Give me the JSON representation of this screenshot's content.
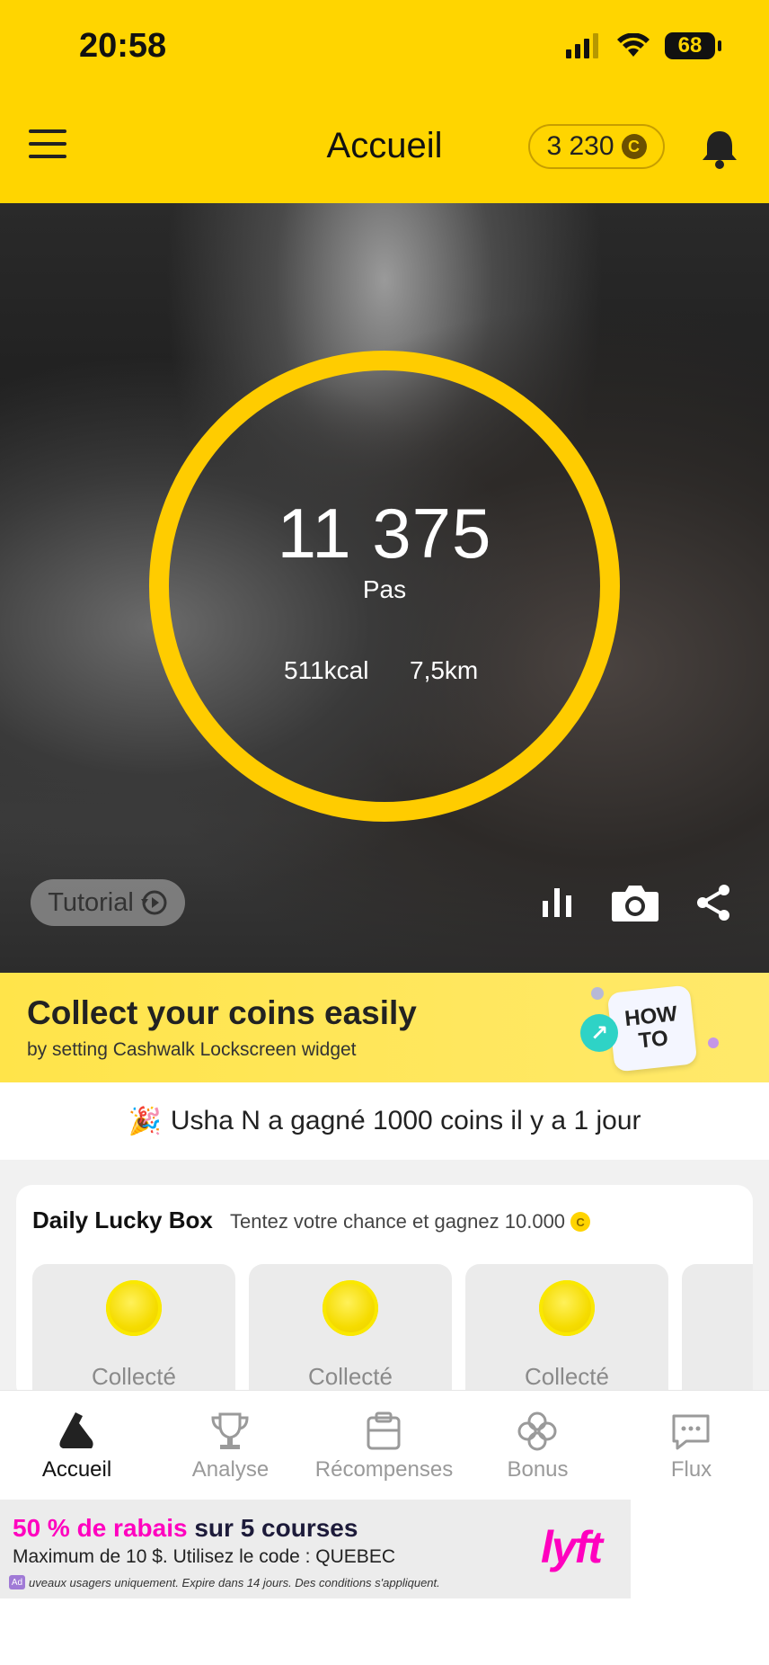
{
  "status_bar": {
    "time": "20:58",
    "battery": "68"
  },
  "header": {
    "title": "Accueil",
    "coins": "3 230",
    "coin_symbol": "C"
  },
  "activity": {
    "steps": "11 375",
    "steps_label": "Pas",
    "calories": "511kcal",
    "distance": "7,5km",
    "ring_color": "#FFCC00"
  },
  "hero_controls": {
    "tutorial_label": "Tutorial",
    "icons": [
      "stats-icon",
      "camera-icon",
      "share-icon"
    ]
  },
  "promo": {
    "title": "Collect your coins easily",
    "subtitle": "by setting Cashwalk Lockscreen widget",
    "howto": "HOW TO"
  },
  "winner": {
    "emoji": "🎉",
    "text": "Usha N a gagné 1000 coins il y a 1 jour"
  },
  "lucky_box": {
    "title": "Daily Lucky Box",
    "subtitle": "Tentez votre chance et gagnez 10.000",
    "coin_symbol": "C",
    "boxes": [
      {
        "label": "Collecté"
      },
      {
        "label": "Collecté"
      },
      {
        "label": "Collecté"
      }
    ]
  },
  "bottom_nav": {
    "items": [
      {
        "label": "Accueil",
        "icon": "shoe-icon",
        "active": true
      },
      {
        "label": "Analyse",
        "icon": "trophy-icon",
        "active": false
      },
      {
        "label": "Récompenses",
        "icon": "clipboard-icon",
        "active": false
      },
      {
        "label": "Bonus",
        "icon": "clover-icon",
        "active": false
      },
      {
        "label": "Flux",
        "icon": "chat-icon",
        "active": false
      }
    ]
  },
  "ad": {
    "line1_highlight": "50 % de rabais",
    "line1_rest": "sur 5 courses",
    "line2": "Maximum de 10 $. Utilisez le code : QUEBEC",
    "line3": "uveaux usagers uniquement. Expire dans 14 jours. Des conditions s'appliquent.",
    "badge": "Ad",
    "brand": "lyft",
    "brand_color": "#FF00BF"
  },
  "colors": {
    "accent": "#FFD500",
    "inactive": "#9a9a9a"
  }
}
